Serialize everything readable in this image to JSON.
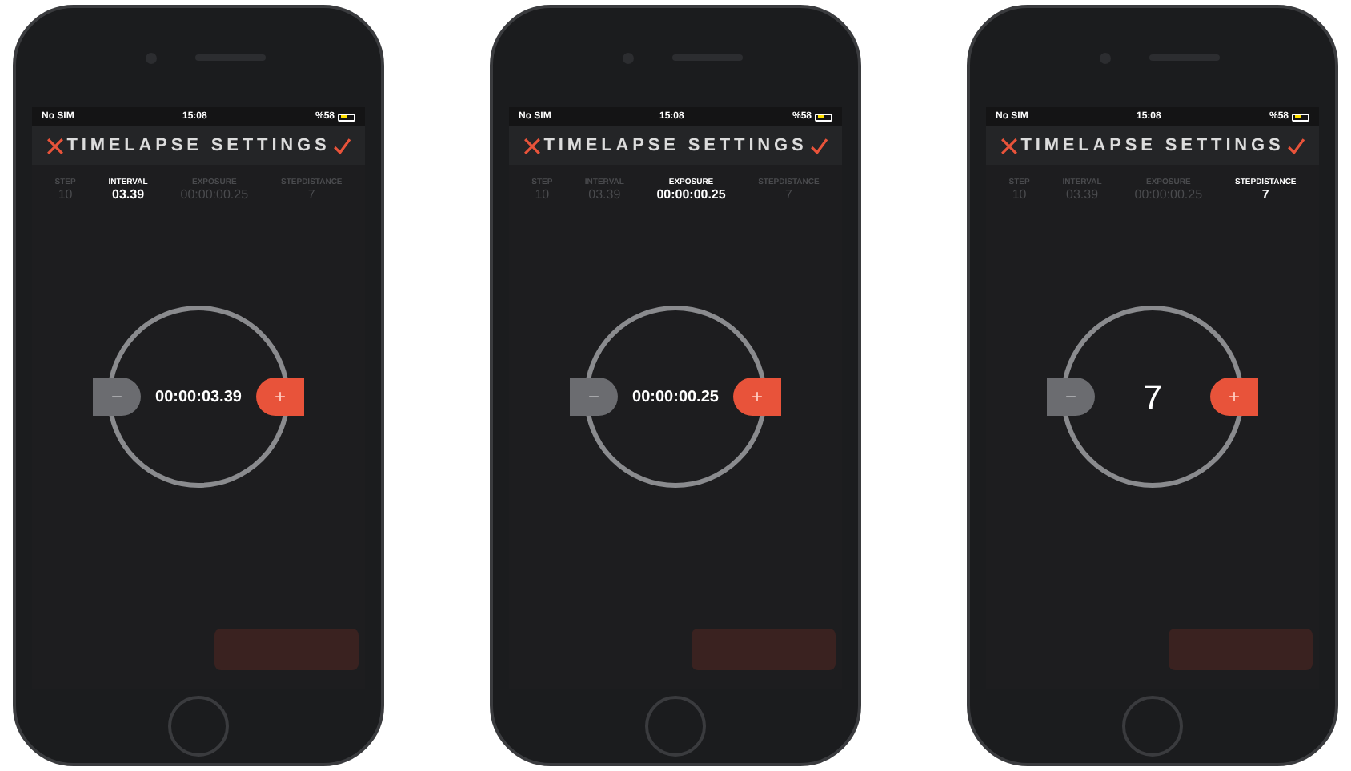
{
  "phones": [
    {
      "status": {
        "carrier": "No SIM",
        "time": "15:08",
        "battery": "%58"
      },
      "title": "TIMELAPSE SETTINGS",
      "tabs": [
        {
          "label": "STEP",
          "value": "10",
          "selected": false
        },
        {
          "label": "INTERVAL",
          "value": "03.39",
          "selected": true
        },
        {
          "label": "EXPOSURE",
          "value": "00:00:00.25",
          "selected": false
        },
        {
          "label": "STEPDISTANCE",
          "value": "7",
          "selected": false
        }
      ],
      "dial": {
        "minus": "−",
        "value": "00:00:03.39",
        "plus": "+"
      }
    },
    {
      "status": {
        "carrier": "No SIM",
        "time": "15:08",
        "battery": "%58"
      },
      "title": "TIMELAPSE SETTINGS",
      "tabs": [
        {
          "label": "STEP",
          "value": "10",
          "selected": false
        },
        {
          "label": "INTERVAL",
          "value": "03.39",
          "selected": false
        },
        {
          "label": "EXPOSURE",
          "value": "00:00:00.25",
          "selected": true
        },
        {
          "label": "STEPDISTANCE",
          "value": "7",
          "selected": false
        }
      ],
      "dial": {
        "minus": "−",
        "value": "00:00:00.25",
        "plus": "+"
      }
    },
    {
      "status": {
        "carrier": "No SIM",
        "time": "15:08",
        "battery": "%58"
      },
      "title": "TIMELAPSE SETTINGS",
      "tabs": [
        {
          "label": "STEP",
          "value": "10",
          "selected": false
        },
        {
          "label": "INTERVAL",
          "value": "03.39",
          "selected": false
        },
        {
          "label": "EXPOSURE",
          "value": "00:00:00.25",
          "selected": false
        },
        {
          "label": "STEPDISTANCE",
          "value": "7",
          "selected": true
        }
      ],
      "dial": {
        "minus": "−",
        "value": "7",
        "plus": "+"
      }
    }
  ]
}
